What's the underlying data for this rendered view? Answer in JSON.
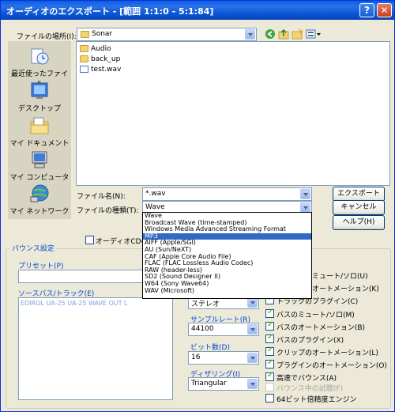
{
  "window": {
    "title": "オーディオのエクスポート - [範囲 1:1:0 - 5:1:84]",
    "help_btn": "?",
    "close_btn": "✕"
  },
  "location": {
    "label": "ファイルの場所(I):",
    "value": "Sonar"
  },
  "places": [
    {
      "label": "最近使ったファイル",
      "icon": "recent-files-icon"
    },
    {
      "label": "デスクトップ",
      "icon": "desktop-icon"
    },
    {
      "label": "マイ ドキュメント",
      "icon": "my-documents-icon"
    },
    {
      "label": "マイ コンピュータ",
      "icon": "my-computer-icon"
    },
    {
      "label": "マイ ネットワーク",
      "icon": "my-network-icon"
    }
  ],
  "files": [
    {
      "name": "Audio",
      "kind": "folder"
    },
    {
      "name": "back_up",
      "kind": "folder"
    },
    {
      "name": "test.wav",
      "kind": "file"
    }
  ],
  "filename": {
    "label": "ファイル名(N):",
    "value": "*.wav"
  },
  "filetype": {
    "label": "ファイルの種類(T):",
    "value": "Wave",
    "options": [
      "Wave",
      "Broadcast Wave (time-stamped)",
      "Windows Media  Advanced Streaming Format",
      "MP3",
      "AIFF (Apple/SGI)",
      "AU (Sun/NeXT)",
      "CAF (Apple Core Audio File)",
      "FLAC (FLAC Lossless Audio Codec)",
      "RAW (header-less)",
      "SD2 (Sound Designer II)",
      "W64 (Sony Wave64)",
      "WAV (Microsoft)"
    ],
    "selected_index": 3
  },
  "buttons": {
    "export": "エクスポート",
    "cancel": "キャンセル",
    "help": "ヘルプ(H)"
  },
  "audio_cd_label": "オーディオCDのトラ",
  "bounce": {
    "group_title": "バウンス設定",
    "preset_label": "プリセット(P)",
    "source_label": "ソースバス/トラック(E)",
    "source_items": [
      "EDIROL UA-25 UA-25 WAVE OUT L"
    ],
    "channel_value": "ステレオ",
    "samplerate_label": "サンプルレート(R)",
    "samplerate_value": "44100",
    "bitdepth_label": "ビット数(D)",
    "bitdepth_value": "16",
    "dither_label": "ディザリング(I)",
    "dither_value": "Triangular"
  },
  "options": [
    {
      "label": "トラックのミュート/ソロ(U)",
      "checked": true,
      "disabled": false
    },
    {
      "label": "トラックのオートメーション(K)",
      "checked": true,
      "disabled": false
    },
    {
      "label": "トラックのプラグイン(C)",
      "checked": true,
      "disabled": false
    },
    {
      "label": "バスのミュート/ソロ(M)",
      "checked": true,
      "disabled": false
    },
    {
      "label": "バスのオートメーション(B)",
      "checked": true,
      "disabled": false
    },
    {
      "label": "バスのプラグイン(X)",
      "checked": true,
      "disabled": false
    },
    {
      "label": "クリップのオートメーション(L)",
      "checked": true,
      "disabled": false
    },
    {
      "label": "プラグインのオートメーション(O)",
      "checked": true,
      "disabled": false
    },
    {
      "label": "高速でバウンス(A)",
      "checked": true,
      "disabled": false
    },
    {
      "label": "バウンス中の試聴(F)",
      "checked": false,
      "disabled": true
    },
    {
      "label": "64ビット倍精度エンジン",
      "checked": false,
      "disabled": false
    }
  ]
}
